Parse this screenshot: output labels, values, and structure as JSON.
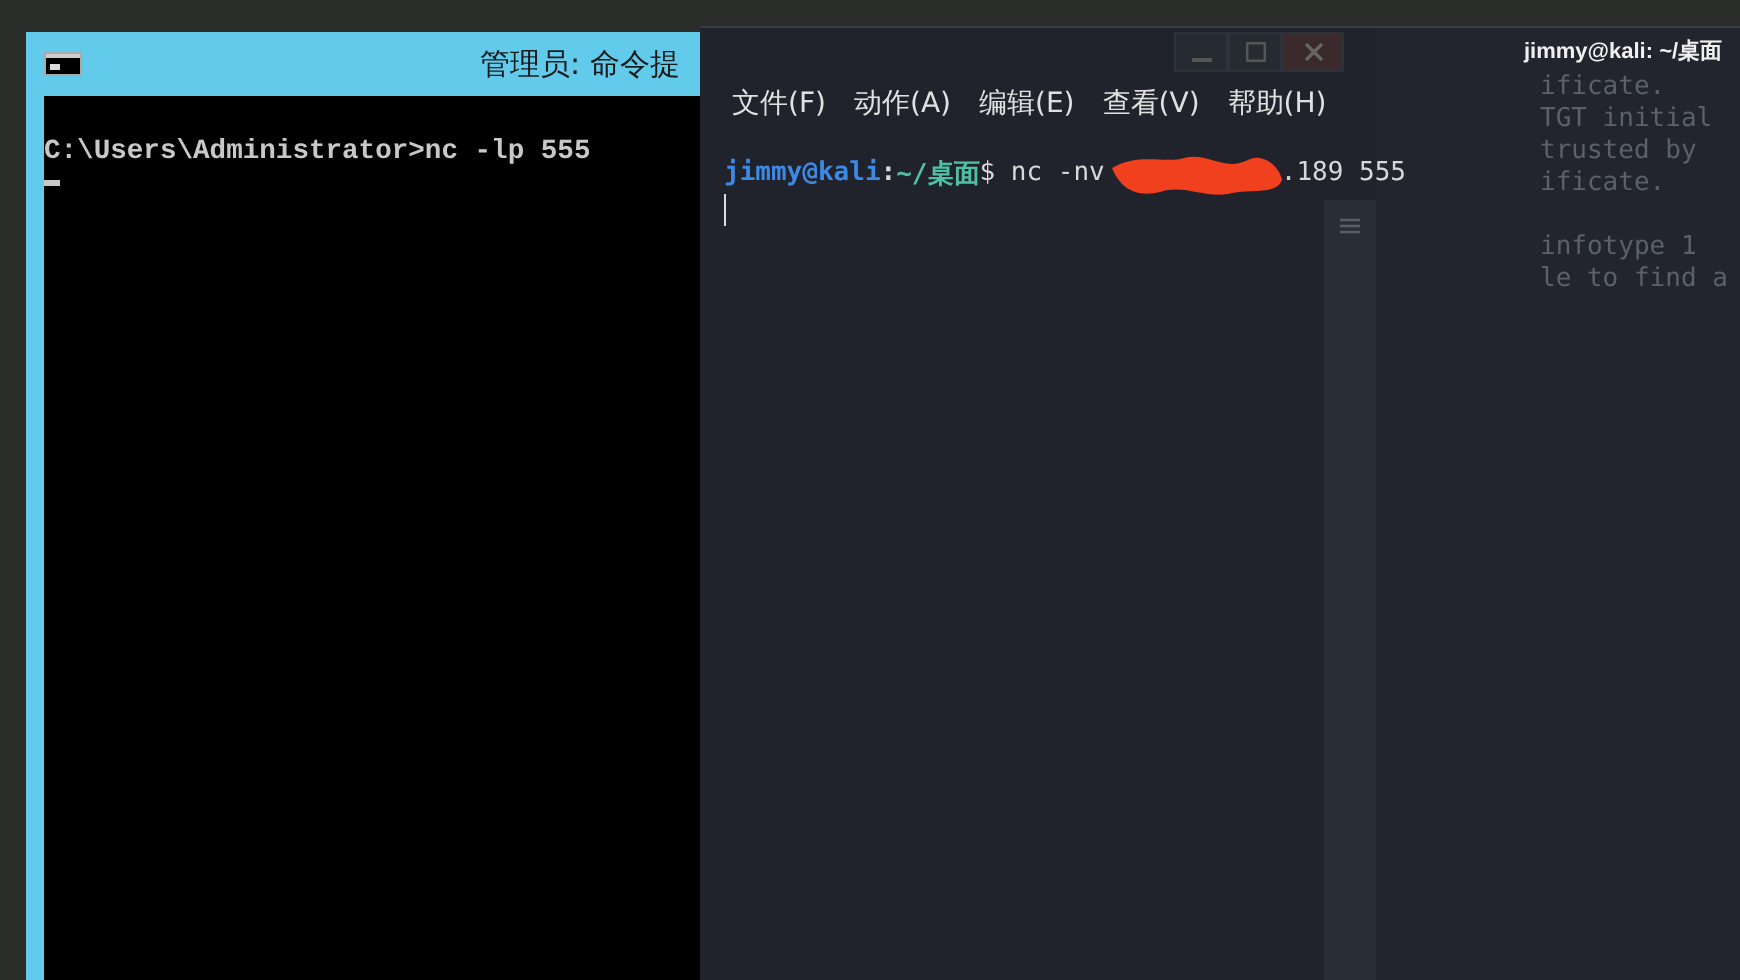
{
  "cmd_window": {
    "title": "管理员: 命令提",
    "lines": [
      "C:\\Users\\Administrator>nc -lp 555"
    ],
    "cursor_visible": true
  },
  "kali_window": {
    "title": "jimmy@kali: ~/桌面",
    "menu": [
      "文件(F)",
      "动作(A)",
      "编辑(E)",
      "查看(V)",
      "帮助(H)"
    ],
    "prompt": {
      "user": "jimmy@kali",
      "separator": ":",
      "path": "~/桌面",
      "command": "$ nc -nv",
      "redacted": true,
      "command_end": ".189 555"
    },
    "cursor_visible": true,
    "background_blocks": [
      [
        "ificate.",
        "TGT initial",
        "trusted by",
        "ificate."
      ],
      [
        "infotype 1",
        "le to find a"
      ]
    ]
  }
}
